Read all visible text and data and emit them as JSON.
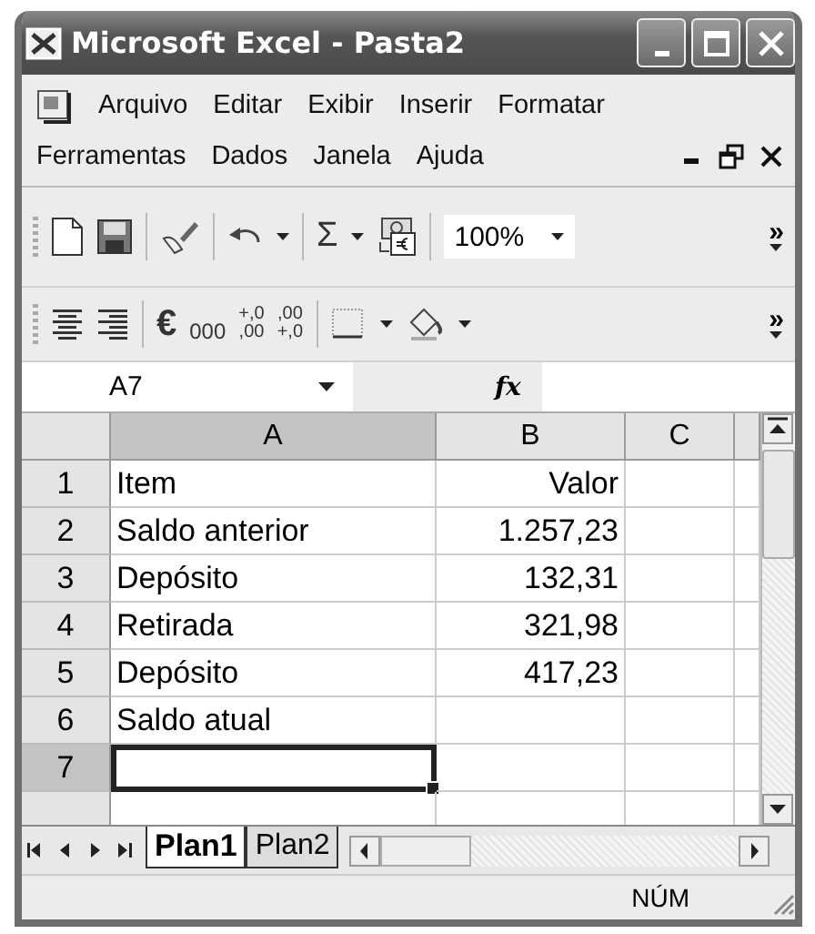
{
  "window": {
    "title": "Microsoft Excel - Pasta2"
  },
  "menu_rows": [
    {
      "items": [
        {
          "label": "Arquivo"
        },
        {
          "label": "Editar"
        },
        {
          "label": "Exibir"
        },
        {
          "label": "Inserir"
        },
        {
          "label": "Formatar"
        }
      ]
    },
    {
      "items": [
        {
          "label": "Ferramentas"
        },
        {
          "label": "Dados"
        },
        {
          "label": "Janela"
        },
        {
          "label": "Ajuda"
        }
      ]
    }
  ],
  "standard_toolbar": {
    "autosum": "Σ",
    "zoom": "100%",
    "more": "»"
  },
  "formatting_toolbar": {
    "currency": "€",
    "thousands": "000",
    "increase_decimal": [
      "+,0",
      ",00"
    ],
    "decrease_decimal": [
      ",00",
      "+,0"
    ],
    "more": "»"
  },
  "formula_bar": {
    "name_box": "A7",
    "function_label": "fx"
  },
  "columns": [
    {
      "label": "A",
      "selected": true
    },
    {
      "label": "B",
      "selected": false
    },
    {
      "label": "C",
      "selected": false
    }
  ],
  "rows": [
    {
      "header": "1",
      "selected": false,
      "cells": [
        "Item",
        "Valor"
      ]
    },
    {
      "header": "2",
      "selected": false,
      "cells": [
        "Saldo anterior",
        "1.257,23"
      ]
    },
    {
      "header": "3",
      "selected": false,
      "cells": [
        "Depósito",
        "132,31"
      ]
    },
    {
      "header": "4",
      "selected": false,
      "cells": [
        "Retirada",
        "321,98"
      ]
    },
    {
      "header": "5",
      "selected": false,
      "cells": [
        "Depósito",
        "417,23"
      ]
    },
    {
      "header": "6",
      "selected": false,
      "cells": [
        "Saldo atual"
      ]
    },
    {
      "header": "7",
      "selected": true
    }
  ],
  "sheet_tabs": [
    {
      "label": "Plan1",
      "selected": true
    },
    {
      "label": "Plan2",
      "selected": false
    }
  ],
  "status_bar": {
    "indicator": "NÚM"
  }
}
